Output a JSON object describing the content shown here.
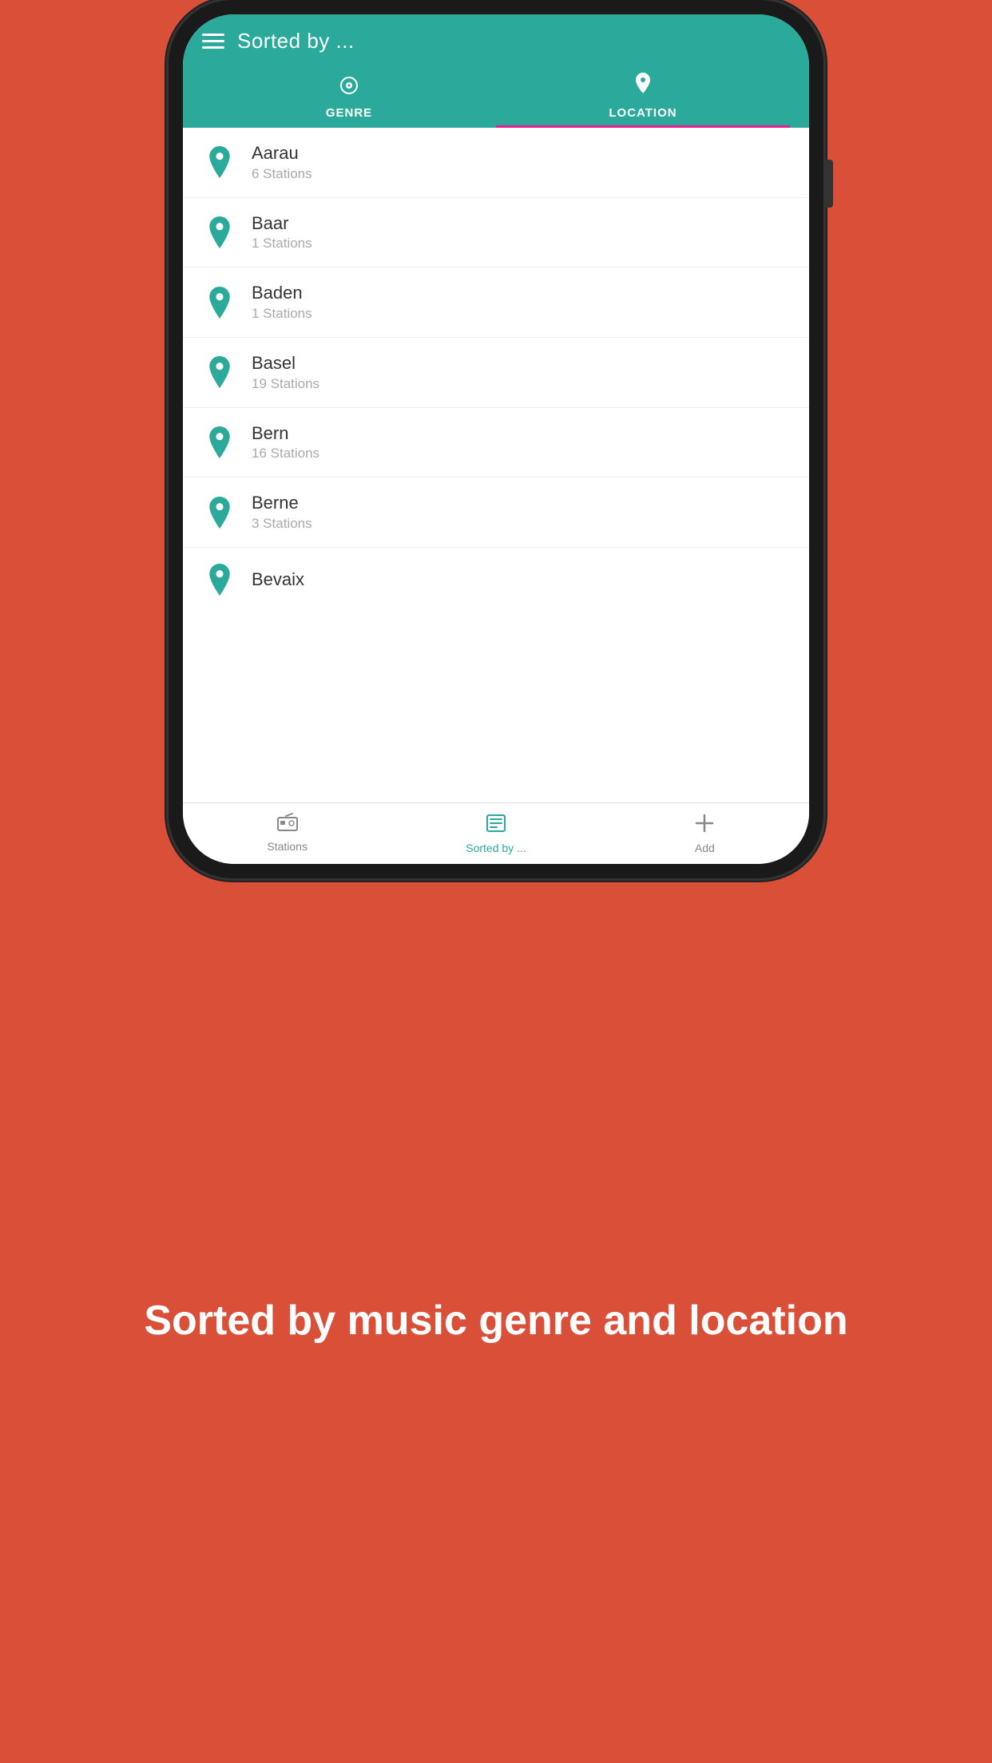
{
  "header": {
    "title": "Sorted by ...",
    "hamburger_label": "menu"
  },
  "tabs": [
    {
      "id": "genre",
      "label": "GENRE",
      "icon": "radio",
      "active": false
    },
    {
      "id": "location",
      "label": "LOCATION",
      "icon": "location",
      "active": true
    }
  ],
  "locations": [
    {
      "name": "Aarau",
      "count": "6 Stations"
    },
    {
      "name": "Baar",
      "count": "1 Stations"
    },
    {
      "name": "Baden",
      "count": "1 Stations"
    },
    {
      "name": "Basel",
      "count": "19 Stations"
    },
    {
      "name": "Bern",
      "count": "16 Stations"
    },
    {
      "name": "Berne",
      "count": "3 Stations"
    },
    {
      "name": "Bevaix",
      "count": ""
    }
  ],
  "bottom_nav": [
    {
      "id": "stations",
      "label": "Stations",
      "icon": "radio",
      "active": false
    },
    {
      "id": "sorted",
      "label": "Sorted by ...",
      "icon": "list",
      "active": true
    },
    {
      "id": "add",
      "label": "Add",
      "icon": "plus",
      "active": false
    }
  ],
  "tagline": "Sorted by music genre and location",
  "colors": {
    "teal": "#2ba99b",
    "pink": "#e91e8c",
    "red": "#d94f38"
  }
}
